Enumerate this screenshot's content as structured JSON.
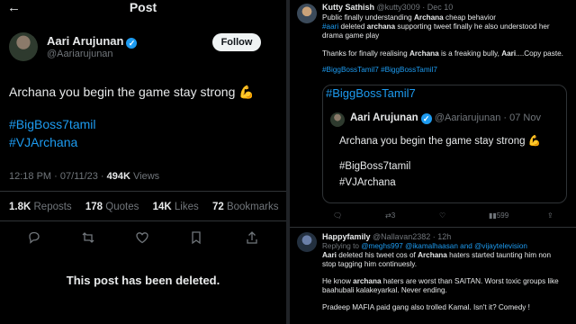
{
  "left_post": {
    "back_glyph": "←",
    "header_title": "Post",
    "author": {
      "name": "Aari Arujunan",
      "handle": "@Aariarujunan"
    },
    "follow_label": "Follow",
    "text": "Archana you begin the game stay strong",
    "text_emoji": "💪",
    "hashtags": [
      "#BigBoss7tamil",
      "#VJArchana"
    ],
    "meta": {
      "time": "12:18 PM · 07/11/23 ·",
      "views_count": "494K",
      "views_label": "Views"
    },
    "stats": [
      {
        "count": "1.8K",
        "label": "Reposts"
      },
      {
        "count": "178",
        "label": "Quotes"
      },
      {
        "count": "14K",
        "label": "Likes"
      },
      {
        "count": "72",
        "label": "Bookmarks"
      }
    ],
    "action_icons": [
      "reply-icon",
      "repost-icon",
      "like-icon",
      "bookmark-icon",
      "share-icon"
    ],
    "deleted_notice": "This post has been deleted."
  },
  "reply1": {
    "name": "Kutty Sathish",
    "meta": "@kutty3009 · Dec 10",
    "line1": "Public finally understanding",
    "line1_bold": "Archana",
    "line1_end": "cheap behavior",
    "line2_blue": "#aari",
    "line2_mid": "deleted",
    "line2_bold": "archana",
    "line2_end": "supporting tweet finally he also understood her",
    "line3": "drama game play",
    "line4_start": "Thanks for finally realising",
    "line4_bold": "Archana",
    "line4_mid": "is a freaking bully,",
    "line4_bold2": "Aari",
    "line4_end": "....Copy paste.",
    "hashtags_line": "#BiggBossTamil7 #BiggBossTamil7",
    "quote_hashtag": "#BiggBossTamil7",
    "quote": {
      "name": "Aari Arujunan",
      "handle_date": "@Aariarujunan · 07 Nov",
      "text": "Archana you begin the game stay strong",
      "emoji": "💪",
      "hashtags": [
        "#BigBoss7tamil",
        "#VJArchana"
      ]
    },
    "actions": {
      "reply": "",
      "repost": "3",
      "like": "",
      "views": "599"
    }
  },
  "reply2": {
    "name": "Happyfamily",
    "meta": "@Nallavan2382 · 12h",
    "replying_to": "Replying to",
    "replying_handles": "@meghs997 @ikamalhaasan and @vijaytelevision",
    "p1_bold": "Aari",
    "p1_a": "deleted his tweet cos of",
    "p1_bold2": "Archana",
    "p1_b": "haters started taunting him non",
    "p1_c": "stop tagging him continuesly.",
    "p2_a": "He know",
    "p2_bold": "archana",
    "p2_b": "haters are worst than SAITAN. Worst toxic groups like",
    "p2_c": "baahubali kalakeyarkal. Never ending.",
    "p3": "Pradeep MAFIA paid gang also trolled Kamal. Isn't it? Comedy !"
  },
  "colors": {
    "accent": "#1d9bf0",
    "muted": "#71767b",
    "text": "#e7e9ea",
    "bg": "#000000"
  }
}
